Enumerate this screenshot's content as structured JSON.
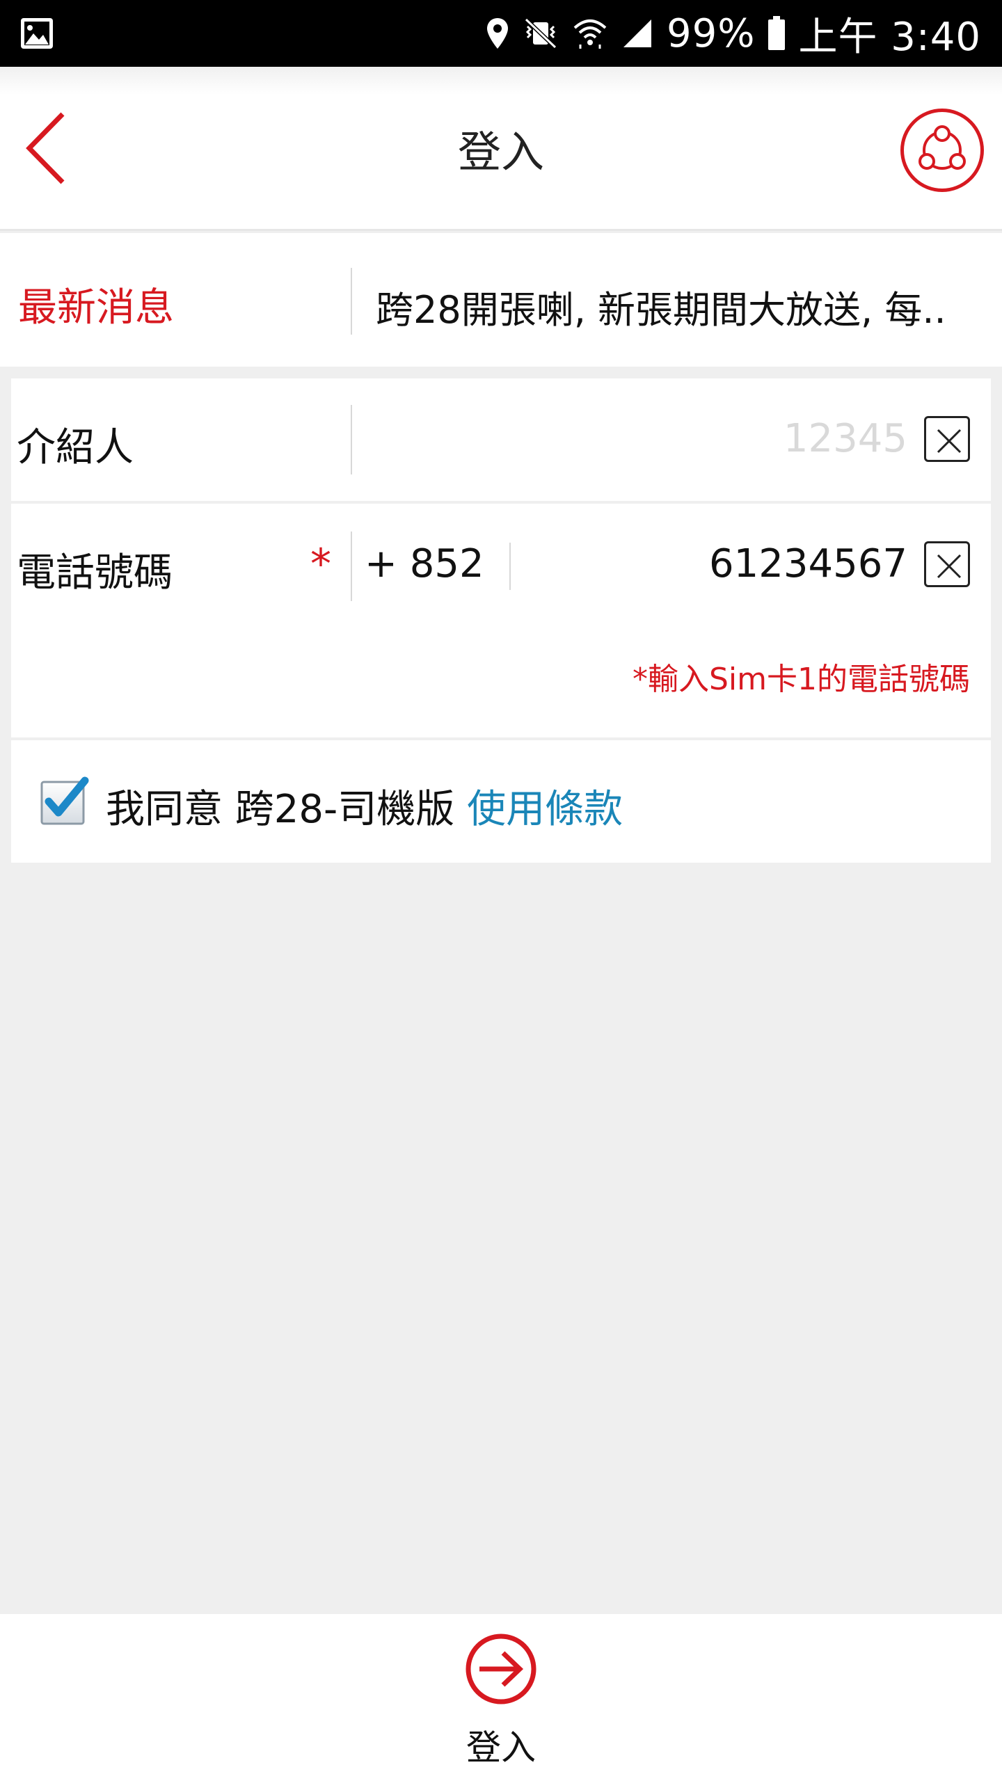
{
  "statusbar": {
    "battery": "99%",
    "time": "上午 3:40"
  },
  "appbar": {
    "title": "登入"
  },
  "news": {
    "label": "最新消息",
    "headline": "跨28開張喇, 新張期間大放送, 每.."
  },
  "referrer": {
    "label": "介紹人",
    "placeholder": "12345"
  },
  "phone": {
    "label": "電話號碼",
    "required_mark": "*",
    "prefix": "+ 852",
    "value": "61234567",
    "hint": "*輸入Sim卡1的電話號碼"
  },
  "agreement": {
    "text": "我同意 跨28-司機版 ",
    "terms_link": "使用條款",
    "checked": true
  },
  "bottom": {
    "login_label": "登入"
  },
  "colors": {
    "accent": "#d71920",
    "link": "#1a86b8"
  }
}
